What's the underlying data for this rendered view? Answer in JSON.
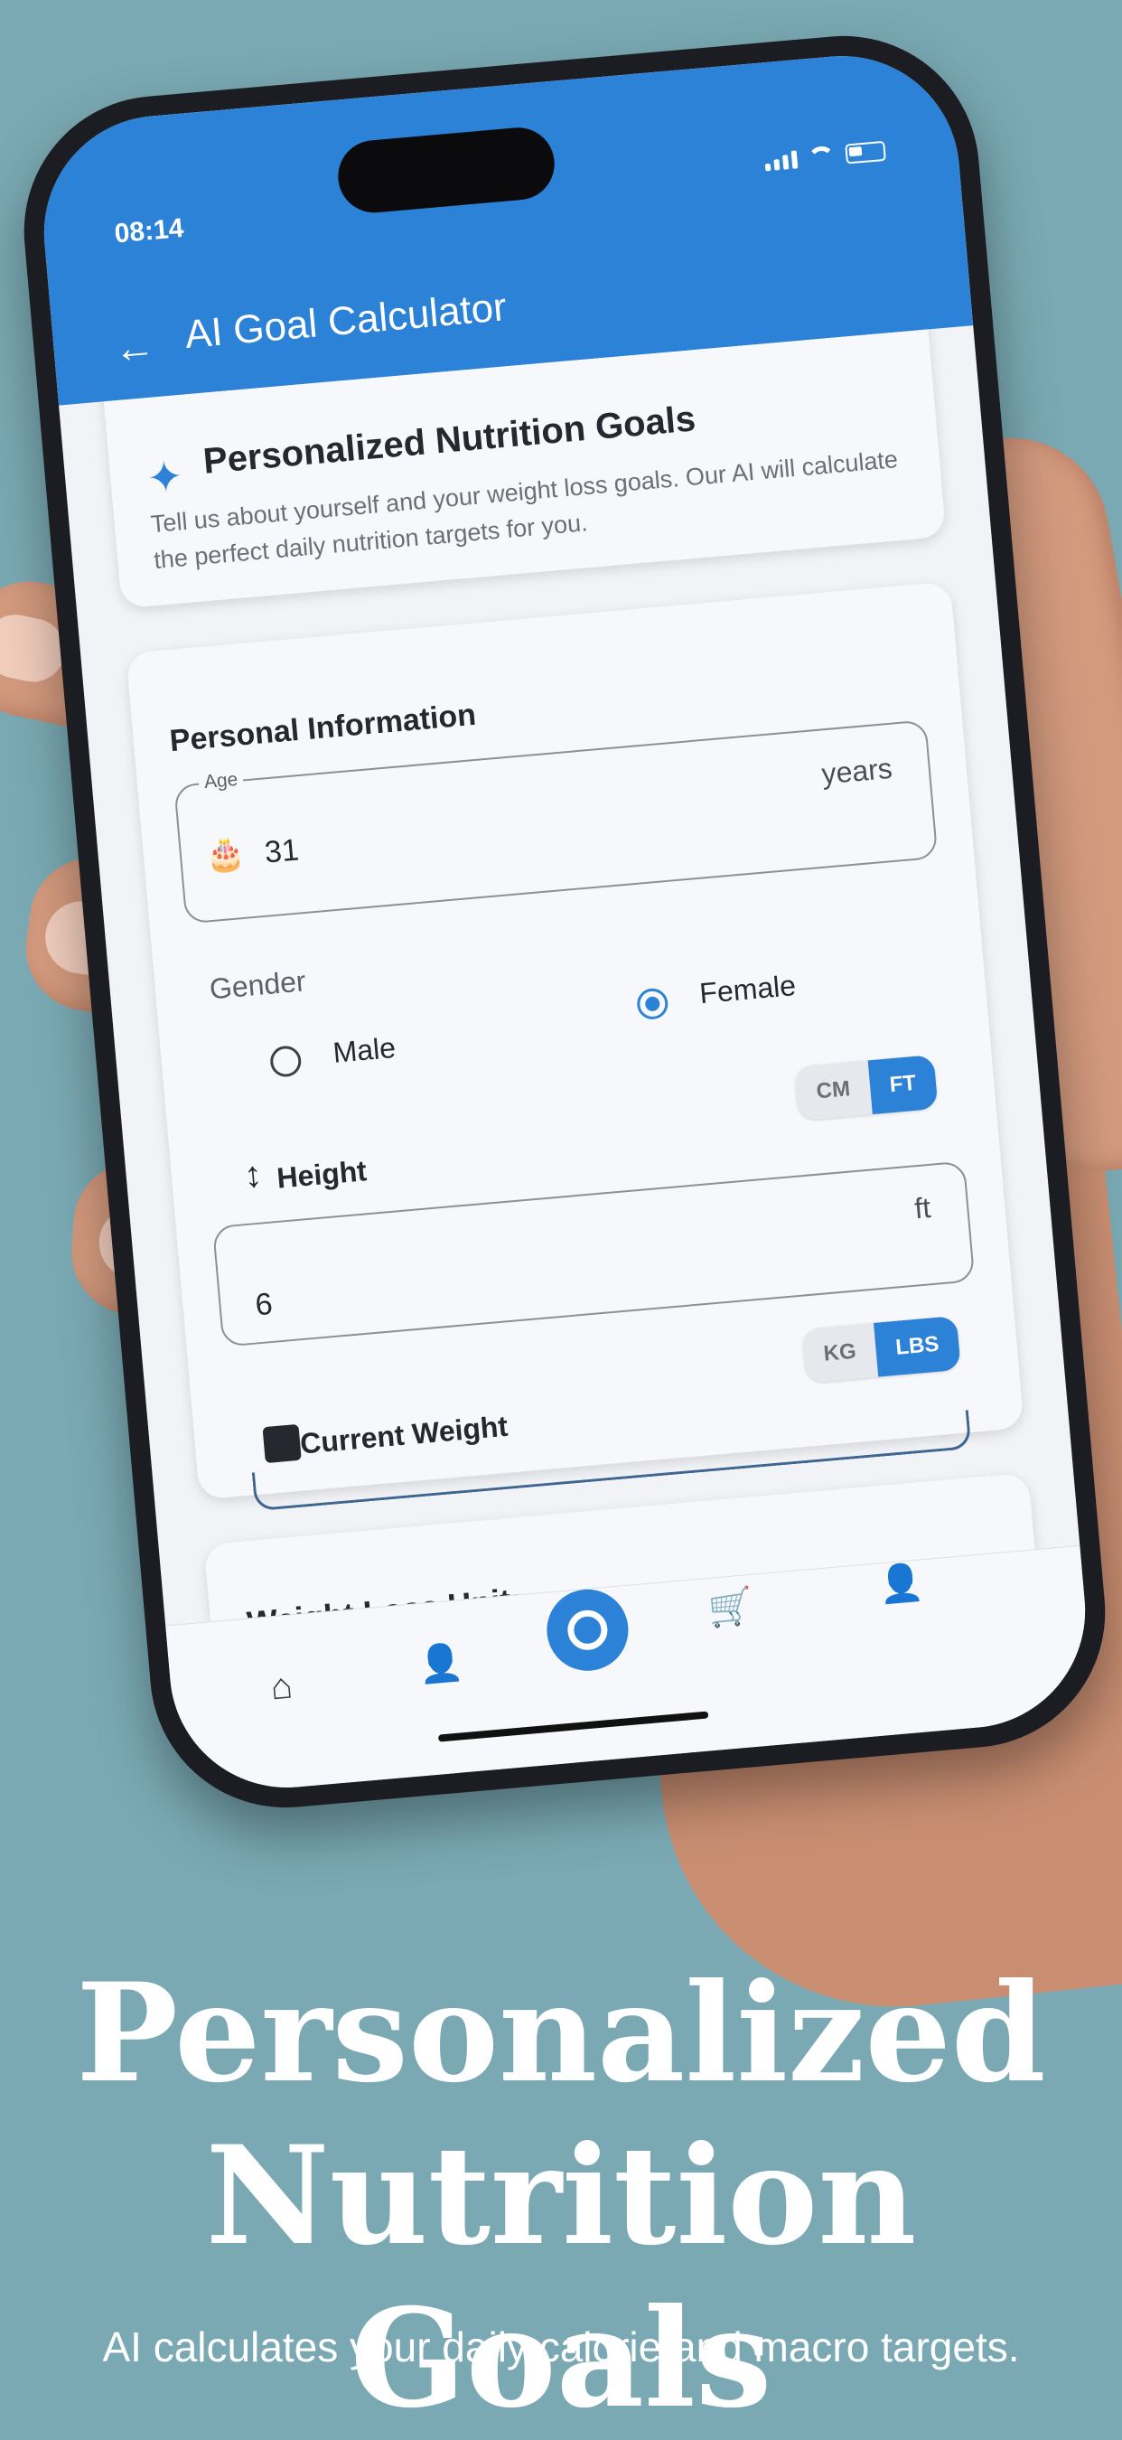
{
  "status_bar": {
    "time": "08:14"
  },
  "app_bar": {
    "back_icon": "arrow-left-icon",
    "title": "AI Goal Calculator"
  },
  "intro_card": {
    "icon": "sparkle-icon",
    "title": "Personalized Nutrition Goals",
    "text": "Tell us about yourself and your weight loss goals. Our AI will calculate the perfect daily nutrition targets for you."
  },
  "personal_info": {
    "title": "Personal Information",
    "age": {
      "label": "Age",
      "value": "31",
      "suffix": "years",
      "icon": "cake-icon"
    },
    "gender": {
      "label": "Gender",
      "options": [
        {
          "label": "Male",
          "selected": false
        },
        {
          "label": "Female",
          "selected": true
        }
      ]
    },
    "height": {
      "label": "Height",
      "icon": "vertical-arrows-icon",
      "units": [
        {
          "label": "CM",
          "selected": false
        },
        {
          "label": "FT",
          "selected": true
        }
      ],
      "value": "6",
      "suffix": "ft"
    },
    "weight": {
      "label": "Current Weight",
      "icon": "scale-icon",
      "units": [
        {
          "label": "KG",
          "selected": false
        },
        {
          "label": "LBS",
          "selected": true
        }
      ]
    }
  },
  "weight_loss_unit": {
    "title": "Weight Loss Unit:"
  },
  "bottom_nav": [
    {
      "icon": "home-icon"
    },
    {
      "icon": "profile-icon"
    },
    {
      "icon": "target-icon"
    },
    {
      "icon": "cart-icon"
    },
    {
      "icon": "profile-icon"
    }
  ],
  "colors": {
    "primary": "#2c82d6",
    "background": "#7aa9b3"
  },
  "marketing": {
    "headline_line1": "Personalized",
    "headline_line2": "Nutrition Goals",
    "subline": "AI calculates your daily calorie and macro targets."
  }
}
